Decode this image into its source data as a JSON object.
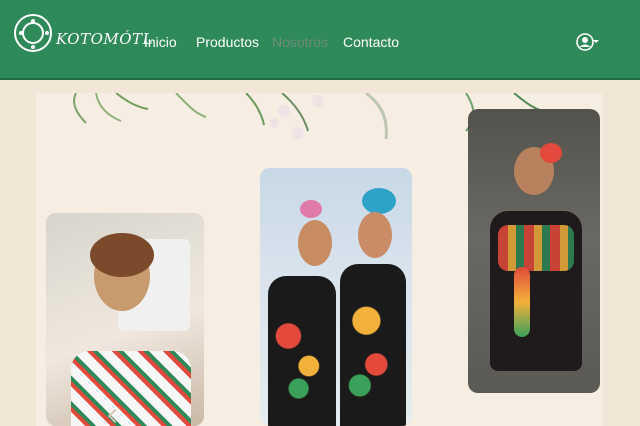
{
  "brand": {
    "name": "KOTOMÓTL"
  },
  "nav": [
    {
      "label": "Inicio"
    },
    {
      "label": "Productos"
    },
    {
      "label": "Nosotros"
    },
    {
      "label": "Contacto"
    }
  ],
  "icons": {
    "user": "user-circle-icon",
    "chevron": "chevron-down-icon"
  },
  "colors": {
    "header": "#2f8a5a",
    "page": "#f2e6d6",
    "content": "#f6ede3"
  }
}
